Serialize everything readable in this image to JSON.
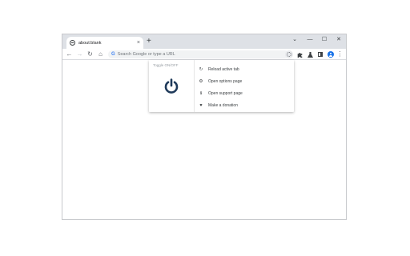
{
  "tab": {
    "title": "about:blank",
    "close": "×",
    "new_tab": "+"
  },
  "window_controls": {
    "dropdown": "⌄",
    "minimize": "—",
    "maximize": "☐",
    "close": "✕"
  },
  "toolbar": {
    "back": "←",
    "forward": "→",
    "reload": "↻",
    "home": "⌂",
    "more": "⋮"
  },
  "omnibox": {
    "google_mark": "G",
    "placeholder": "Search Google or type a URL"
  },
  "popup": {
    "toggle_label": "Toggle ON/OFF",
    "menu": [
      {
        "icon": "reload-icon",
        "glyph": "↻",
        "label": "Reload active tab"
      },
      {
        "icon": "gear-icon",
        "glyph": "⚙",
        "label": "Open options page"
      },
      {
        "icon": "info-icon",
        "glyph": "ℹ",
        "label": "Open support page"
      },
      {
        "icon": "heart-icon",
        "glyph": "♥",
        "label": "Make a donation"
      }
    ]
  },
  "colors": {
    "power_icon": "#1f3a5a",
    "tabstrip": "#dee1e6",
    "accent": "#1a73e8"
  }
}
